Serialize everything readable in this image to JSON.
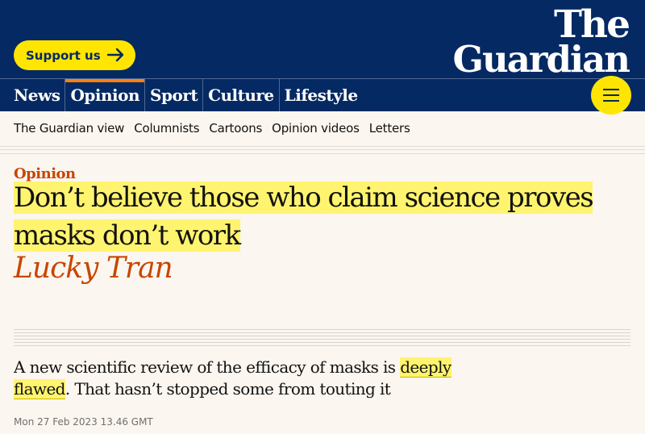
{
  "header": {
    "support_label": "Support us",
    "logo_line1": "The",
    "logo_line2": "Guardian",
    "pillars": [
      {
        "label": "News"
      },
      {
        "label": "Opinion"
      },
      {
        "label": "Sport"
      },
      {
        "label": "Culture"
      },
      {
        "label": "Lifestyle"
      }
    ],
    "active_pillar": "Opinion"
  },
  "subnav": {
    "items": [
      "The Guardian view",
      "Columnists",
      "Cartoons",
      "Opinion videos",
      "Letters"
    ]
  },
  "article": {
    "section": "Opinion",
    "headline": "Don’t believe those who claim science proves masks don’t work",
    "byline": "Lucky Tran",
    "standfirst_before": "A new scientific review of the efficacy of masks is ",
    "standfirst_link": "deeply flawed",
    "standfirst_after": ". That hasn’t stopped some from touting it",
    "dateline": "Mon 27 Feb 2023 13.46 GMT"
  },
  "colors": {
    "brand_blue": "#052962",
    "yellow": "#ffe500",
    "highlight": "#fff46f",
    "opinion_orange": "#c74600",
    "active_tab": "#ff7f0f",
    "background": "#fbf6ef"
  }
}
